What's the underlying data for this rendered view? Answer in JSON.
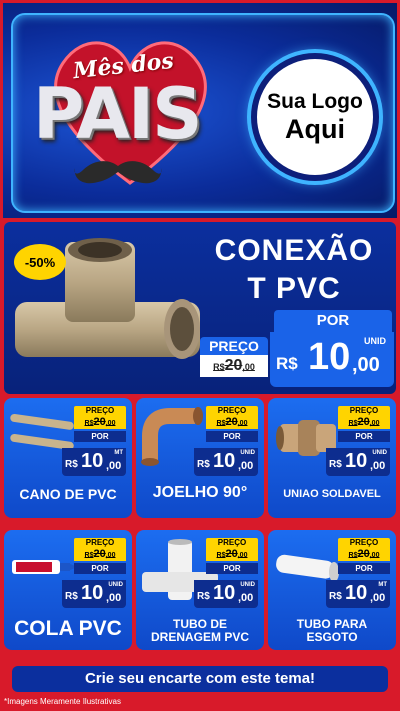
{
  "header": {
    "brand_top": "Mês dos",
    "brand_main": "PAIS",
    "logo_line1": "Sua Logo",
    "logo_line2": "Aqui"
  },
  "hero": {
    "discount": "-50%",
    "title_line1": "CONEXÃO",
    "title_line2": "T PVC",
    "por": "POR",
    "preco_label": "PREÇO",
    "old_prefix": "R$",
    "old_int": "20",
    "old_dec": ",00",
    "currency": "R$",
    "price_int": "10",
    "price_dec": ",00",
    "unit": "UNID"
  },
  "products": [
    {
      "name": "CANO DE PVC",
      "preco": "PREÇO",
      "old_prefix": "R$",
      "old_int": "20",
      "old_dec": ",00",
      "por": "POR",
      "currency": "R$",
      "price_int": "10",
      "price_dec": ",00",
      "unit": "MT",
      "icon": "pipe-icon"
    },
    {
      "name": "JOELHO 90°",
      "preco": "PREÇO",
      "old_prefix": "R$",
      "old_int": "20",
      "old_dec": ",00",
      "por": "POR",
      "currency": "R$",
      "price_int": "10",
      "price_dec": ",00",
      "unit": "UNID",
      "icon": "elbow-icon"
    },
    {
      "name": "UNIAO SOLDAVEL",
      "preco": "PREÇO",
      "old_prefix": "R$",
      "old_int": "20",
      "old_dec": ",00",
      "por": "POR",
      "currency": "R$",
      "price_int": "10",
      "price_dec": ",00",
      "unit": "UNID",
      "icon": "union-icon"
    },
    {
      "name": "COLA PVC",
      "preco": "PREÇO",
      "old_prefix": "R$",
      "old_int": "20",
      "old_dec": ",00",
      "por": "POR",
      "currency": "R$",
      "price_int": "10",
      "price_dec": ",00",
      "unit": "UNID",
      "icon": "glue-icon"
    },
    {
      "name_line1": "TUBO DE",
      "name_line2": "DRENAGEM PVC",
      "preco": "PREÇO",
      "old_prefix": "R$",
      "old_int": "20",
      "old_dec": ",00",
      "por": "POR",
      "currency": "R$",
      "price_int": "10",
      "price_dec": ",00",
      "unit": "UNID",
      "icon": "drain-tube-icon"
    },
    {
      "name_line1": "TUBO PARA",
      "name_line2": "ESGOTO",
      "preco": "PREÇO",
      "old_prefix": "R$",
      "old_int": "20",
      "old_dec": ",00",
      "por": "POR",
      "currency": "R$",
      "price_int": "10",
      "price_dec": ",00",
      "unit": "MT",
      "icon": "sewer-tube-icon"
    }
  ],
  "cta": "Crie seu encarte com este tema!",
  "disclaimer": "*Imagens Meramente Ilustrativas",
  "colors": {
    "red": "#d81a2a",
    "blue": "#1a63e8",
    "navy": "#0b2f9e",
    "yellow": "#ffd400"
  }
}
